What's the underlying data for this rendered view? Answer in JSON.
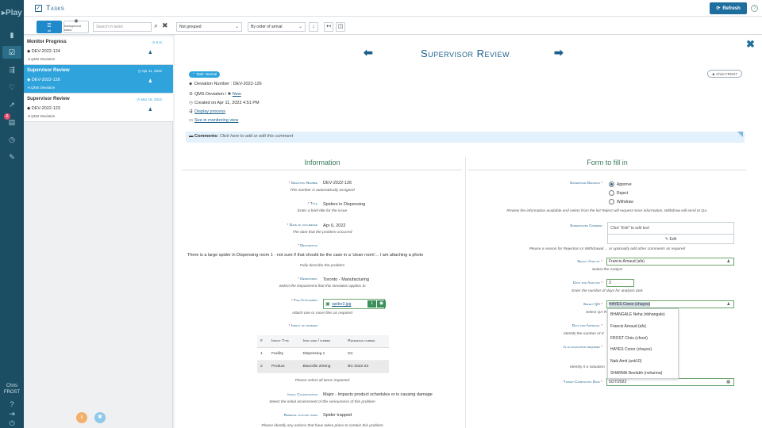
{
  "app": {
    "logo": "Play",
    "user_lines": [
      "Chris",
      "FROST"
    ],
    "badge": "6"
  },
  "header": {
    "title": "Tasks",
    "refresh_label": "Refresh",
    "help": "?"
  },
  "toolbar": {
    "all_label": "all",
    "bg_label": "background tasks",
    "search_placeholder": "Search in tasks",
    "group_value": "Not grouped",
    "order_value": "By order of arrival"
  },
  "task_list": [
    {
      "title": "Monitor Progress",
      "date": "9 m",
      "number": "DEV-2022-124",
      "type": "QMS Deviation",
      "selected": false
    },
    {
      "title": "Supervisor Review",
      "date": "Apr 11, 2022",
      "number": "DEV-2022-126",
      "type": "QMS Deviation",
      "selected": true
    },
    {
      "title": "Supervisor Review",
      "date": "Mar 18, 2022",
      "number": "DEV-2022-123",
      "type": "QMS Deviation",
      "selected": false
    }
  ],
  "detail": {
    "title": "Supervisor Review",
    "task_chip": "Task: Normal",
    "owner": "Chris FROST",
    "deviation_number_line": "Deviation Number : DEV-2022-126",
    "type_line": "QMS Deviation /",
    "new_link": "New",
    "created_line": "Created on Apr 11, 2022 4:51 PM",
    "display_process": "Display process",
    "see_monitoring": "See in monitoring view",
    "comments_label": "Comments:",
    "comments_hint": "Click here to add or edit this comment"
  },
  "information": {
    "heading": "Information",
    "deviation_number": {
      "label": "Deviation Number",
      "value": "DEV-2022-126",
      "hint": "This number is automatically assigned"
    },
    "title": {
      "label": "Title",
      "value": "Spiders in Dispensing",
      "hint": "Enter a brief title for the issue"
    },
    "date": {
      "label": "Date of occurence",
      "value": "Apr 6, 2022",
      "hint": "The date that the problem occurred"
    },
    "description": {
      "label": "Description",
      "value": "There is a large spider in Dispensing room 1 - not sure if that should be the case in a 'clean room'... I am attaching a photo",
      "hint": "Fully describe the problem"
    },
    "department": {
      "label": "Department",
      "value": "Toronto - Manufacturing",
      "hint": "Select the Department that this Deviation applies to"
    },
    "file": {
      "label": "File Attachment",
      "value": "spider2.jpg",
      "hint": "Attach one or more files as required"
    },
    "impact": {
      "label": "Impact of problem",
      "hint": "Please select all items impacted",
      "columns": [
        "#",
        "Impact Type",
        "Item name / number",
        "Reference number"
      ],
      "rows": [
        [
          "1",
          "Facility",
          "Dispensing 1",
          "D1"
        ],
        [
          "2",
          "Product",
          "Bluecillin 200mg",
          "BC-2022-23"
        ]
      ]
    },
    "classification": {
      "label": "Initial Classification",
      "value": "Major - Impacts product schedules or is causing damage",
      "hint": "Select the initial assessment of the seriousness of this problem"
    },
    "remedial": {
      "label": "Remedial actions taken",
      "value": "Spider trapped",
      "hint": "Please identify any actions that have taken place to contain this problem"
    }
  },
  "form": {
    "heading": "Form to fill in",
    "decision": {
      "label": "Supervisor Decision",
      "options": [
        "Approve",
        "Reject",
        "Withdraw"
      ],
      "selected": "Approve",
      "hint": "Review the information available and select from the list Reject will request more information, Withdraw will send to QA."
    },
    "comment": {
      "label": "Supervisors Comment",
      "placeholder": "Click \"Edit\" to edit text",
      "edit_label": "Edit",
      "hint": "Please a reason for Rejection or Withdrawal ... or optionally add other comments as required"
    },
    "analyst": {
      "label": "Select Analyst",
      "value": "Francis Arnaud (afs)",
      "hint": "Select the Analyst"
    },
    "days_analysis": {
      "label": "Days for Analysis",
      "value": "3",
      "hint": "Enter the number of days for analysis task"
    },
    "qa": {
      "label": "Select QA",
      "value": "HAYES Conor (chayes)",
      "hint": "Select QA R"
    },
    "days_approval": {
      "label": "Days for Approval",
      "hint": "Identify the number of d"
    },
    "evaluation": {
      "label": "Is an evaluation required",
      "hint": "Identify if a valuation"
    },
    "target_date": {
      "label": "Target Completion Date",
      "value": "5/27/2022"
    },
    "qa_options": [
      "BHANGALE Neha (nbhangale)",
      "Francis Arnaud (afs)",
      "FROST Chris (cfrost)",
      "HAYES Conor (chayes)",
      "Naik Amit (ank10)",
      "SHARMA Neelabh (nsharma)"
    ]
  }
}
